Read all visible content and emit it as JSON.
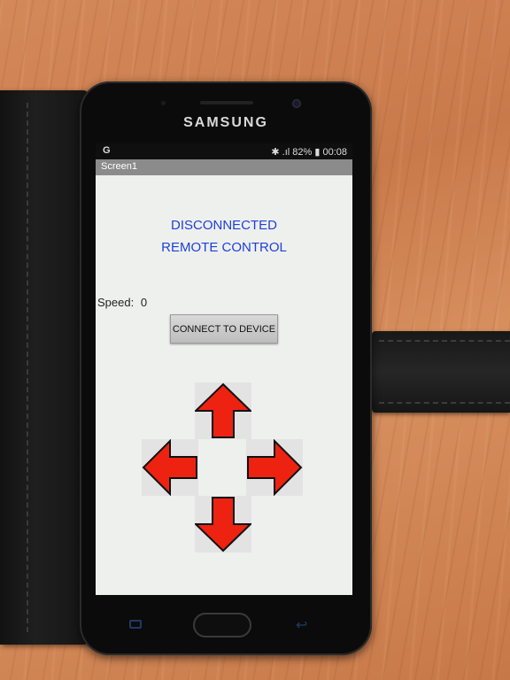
{
  "phone": {
    "brand": "SAMSUNG"
  },
  "status_bar": {
    "left_icon": "G",
    "right_text": "✱ .ıl 82% ▮ 00:08"
  },
  "app": {
    "title_bar": "Screen1",
    "heading_line1": "DISCONNECTED",
    "heading_line2": "REMOTE CONTROL",
    "speed_label": "Speed:",
    "speed_value": "0",
    "connect_button": "CONNECT TO DEVICE",
    "arrows": [
      "up-arrow-button",
      "left-arrow-button",
      "right-arrow-button",
      "down-arrow-button"
    ],
    "arrow_color": "#ee2211",
    "heading_color": "#1f3fd8"
  },
  "nav_icons": [
    "recents-icon",
    "home-button",
    "back-icon"
  ]
}
